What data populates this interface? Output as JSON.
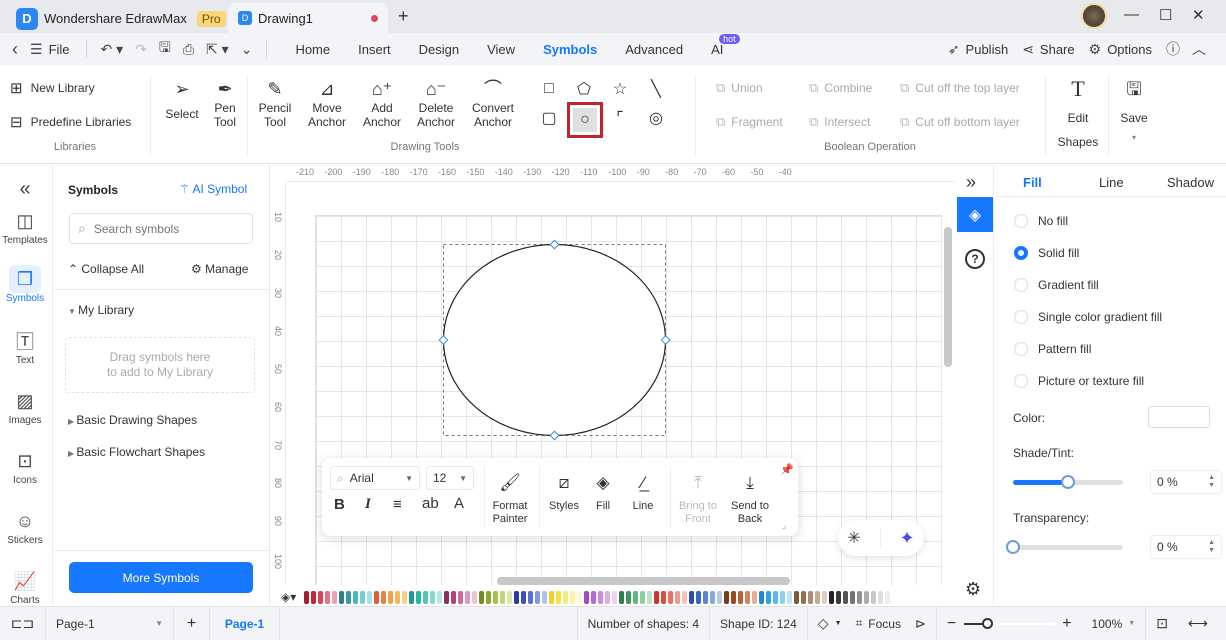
{
  "titlebar": {
    "app_name": "Wondershare EdrawMax",
    "badge": "Pro",
    "document_tab": "Drawing1",
    "new_tab": "+",
    "minimize": "—",
    "maximize": "☐",
    "close": "✕"
  },
  "menubar": {
    "back": "‹",
    "file": "File",
    "items": [
      "Home",
      "Insert",
      "Design",
      "View",
      "Symbols",
      "Advanced",
      "AI"
    ],
    "active": "Symbols",
    "ai_badge": "hot",
    "publish": "Publish",
    "share": "Share",
    "options": "Options"
  },
  "ribbon": {
    "libraries": {
      "label": "Libraries",
      "new_library": "New Library",
      "predefine_libraries": "Predefine Libraries"
    },
    "drawing_tools": {
      "label": "Drawing Tools",
      "select": "Select",
      "pen": [
        "Pen",
        "Tool"
      ],
      "pencil": [
        "Pencil",
        "Tool"
      ],
      "move_anchor": [
        "Move",
        "Anchor"
      ],
      "add_anchor": [
        "Add",
        "Anchor"
      ],
      "delete_anchor": [
        "Delete",
        "Anchor"
      ],
      "convert_anchor": [
        "Convert",
        "Anchor"
      ],
      "shapes": [
        "rectangle",
        "pentagon",
        "star",
        "line",
        "rounded-rectangle",
        "ellipse",
        "arc",
        "spiral"
      ],
      "selected_shape": "ellipse"
    },
    "boolean": {
      "label": "Boolean Operation",
      "union": "Union",
      "combine": "Combine",
      "cut_top": "Cut off the top layer",
      "fragment": "Fragment",
      "intersect": "Intersect",
      "cut_bottom": "Cut off bottom layer"
    },
    "edit_shapes": [
      "Edit",
      "Shapes"
    ],
    "save": "Save"
  },
  "rail": {
    "items": [
      "Templates",
      "Symbols",
      "Text",
      "Images",
      "Icons",
      "Stickers",
      "Charts"
    ],
    "active": "Symbols"
  },
  "library_panel": {
    "title": "Symbols",
    "ai_symbol": "AI Symbol",
    "search_placeholder": "Search symbols",
    "collapse_all": "Collapse All",
    "manage": "Manage",
    "my_library": "My Library",
    "dropzone": [
      "Drag symbols here",
      "to add to My Library"
    ],
    "sections": [
      "Basic Drawing Shapes",
      "Basic Flowchart Shapes"
    ],
    "more_symbols": "More Symbols"
  },
  "canvas": {
    "ruler_top": [
      "-210",
      "-200",
      "-190",
      "-180",
      "-170",
      "-160",
      "-150",
      "-140",
      "-130",
      "-120",
      "-110",
      "-100",
      "-90",
      "-80",
      "-70",
      "-60",
      "-50",
      "-40"
    ],
    "ruler_left": [
      "10",
      "20",
      "30",
      "40",
      "50",
      "60",
      "70",
      "80",
      "90",
      "100"
    ]
  },
  "float_toolbar": {
    "font": "Arial",
    "size": "12",
    "format_painter": [
      "Format",
      "Painter"
    ],
    "styles": "Styles",
    "fill": "Fill",
    "line": "Line",
    "bring_front": [
      "Bring to",
      "Front"
    ],
    "send_back": [
      "Send to",
      "Back"
    ]
  },
  "palette": [
    "#a31f2c",
    "#c02b3b",
    "#d9455a",
    "#e77489",
    "#f0a1b0",
    "#2e7d8c",
    "#3a98a8",
    "#4fb3c2",
    "#76ccd7",
    "#a6e2ea",
    "#d9613a",
    "#e8833f",
    "#f0a04b",
    "#f5b860",
    "#f8cf86",
    "#1d9a89",
    "#28b5a2",
    "#52c7b5",
    "#85d9cb",
    "#b6eae0",
    "#8e2e5e",
    "#b14377",
    "#cc6c98",
    "#df97b7",
    "#eec3d5",
    "#6e8e1f",
    "#8aa82a",
    "#a6c247",
    "#c0d678",
    "#d8e8a8",
    "#2c3b9a",
    "#3c4fbf",
    "#5b6fd4",
    "#8796e3",
    "#b5bfee",
    "#f0d21d",
    "#f5e04a",
    "#f8ea7c",
    "#fbf2a8",
    "#fdf8d3",
    "#a349c2",
    "#b967d3",
    "#ca8ade",
    "#dbadea",
    "#ecd2f4",
    "#2f7d4a",
    "#3f9b5d",
    "#63b67b",
    "#8fcc9f",
    "#bde1c6",
    "#c8352e",
    "#df4c40",
    "#e8716a",
    "#f19a94",
    "#f7c3bf",
    "#2a4fa3",
    "#3768c4",
    "#5b86d6",
    "#86a8e3",
    "#b5cbf0",
    "#7c3a16",
    "#9c4a1f",
    "#b9603a",
    "#cf8366",
    "#e4ae9a",
    "#1f8ac9",
    "#33a2df",
    "#5ab9ea",
    "#8bcff2",
    "#bde4f8",
    "#7a5a3a",
    "#93704d",
    "#ae8c6c",
    "#c6ac92",
    "#ded0c0",
    "#222222",
    "#3a3a3a",
    "#555555",
    "#727272",
    "#909090",
    "#aeaeae",
    "#c8c8c8",
    "#dedede",
    "#eeeeee"
  ],
  "right_panel": {
    "tabs": [
      "Fill",
      "Line",
      "Shadow"
    ],
    "active_tab": "Fill",
    "fill_options": [
      "No fill",
      "Solid fill",
      "Gradient fill",
      "Single color gradient fill",
      "Pattern fill",
      "Picture or texture fill"
    ],
    "selected_fill": "Solid fill",
    "color_label": "Color:",
    "color_value": "#ffffff",
    "shade_label": "Shade/Tint:",
    "shade_slider": 0.5,
    "shade_value": "0 %",
    "transparency_label": "Transparency:",
    "transparency_slider": 0,
    "transparency_value": "0 %"
  },
  "status": {
    "page_select": "Page-1",
    "active_page": "Page-1",
    "shapes": "Number of shapes: 4",
    "shape_id": "Shape ID: 124",
    "focus": "Focus",
    "zoom": "100%",
    "zoom_slider": 0.25
  }
}
